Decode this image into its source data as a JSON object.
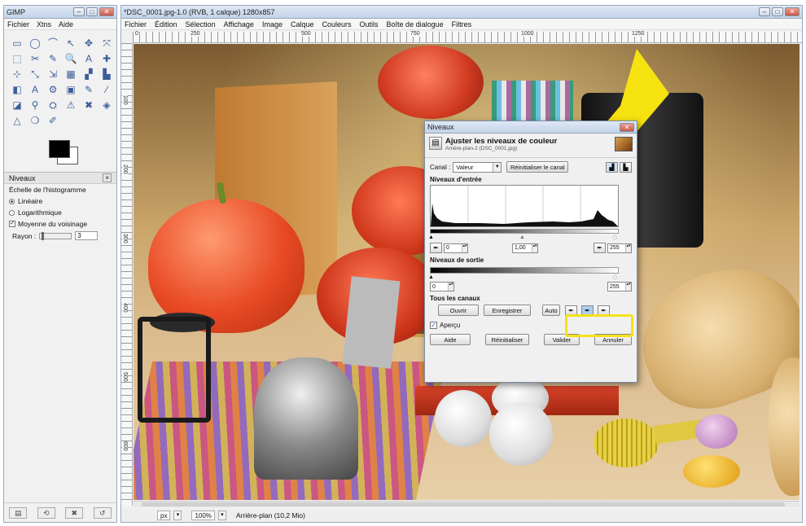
{
  "toolbox": {
    "title": "GIMP",
    "menu": [
      "Fichier",
      "Xtns",
      "Aide"
    ],
    "tools": [
      "▭",
      "◯",
      "⌒",
      "↖",
      "✥",
      "⤧",
      "⬚",
      "✂",
      "✎",
      "🔍",
      "A",
      "✚",
      "⊹",
      "⤡",
      "⇲",
      "▦",
      "▞",
      "▙",
      "◧",
      "A",
      "⚙",
      "▣",
      "✎",
      "∕",
      "◪",
      "⚲",
      "⛭",
      "⚠",
      "✖",
      "◈",
      "△",
      "❍",
      "✐"
    ],
    "options_tab": "Niveaux",
    "scale_label": "Échelle de l'histogramme",
    "scale_linear": "Linéaire",
    "scale_log": "Logarithmique",
    "average_label": "Moyenne du voisinage",
    "radius_label": "Rayon :",
    "radius_value": "3"
  },
  "image_window": {
    "title": "*DSC_0001.jpg-1.0 (RVB, 1 calque) 1280x857",
    "menu": [
      "Fichier",
      "Édition",
      "Sélection",
      "Affichage",
      "Image",
      "Calque",
      "Couleurs",
      "Outils",
      "Boîte de dialogue",
      "Filtres"
    ],
    "ruler_top_labels": [
      "0",
      "250",
      "500",
      "750",
      "1000",
      "1250"
    ],
    "ruler_left_labels": [
      "100",
      "200",
      "300",
      "400",
      "500",
      "600"
    ],
    "status": {
      "unit": "px",
      "zoom": "100%",
      "layer_info": "Arrière-plan (10,2 Mio)"
    }
  },
  "dialog": {
    "title": "Niveaux",
    "headline": "Ajuster les niveaux de couleur",
    "subline": "Arrière-plan-2 (DSC_0001.jpg)",
    "channel_label": "Canal :",
    "channel_value": "Valeur",
    "reset_channel": "Réinitialiser le canal",
    "input_levels": "Niveaux d'entrée",
    "input_black": "0",
    "input_gamma": "1,00",
    "input_white": "255",
    "output_levels": "Niveaux de sortie",
    "output_black": "0",
    "output_white": "255",
    "all_channels": "Tous les canaux",
    "open": "Ouvrir",
    "save": "Enregistrer",
    "auto": "Auto",
    "preview": "Aperçu",
    "help": "Aide",
    "reset": "Réinitialiser",
    "ok": "Valider",
    "cancel": "Annuler"
  },
  "colors": {
    "highlight": "#f4e11a",
    "arrow": "#f6e20f"
  }
}
